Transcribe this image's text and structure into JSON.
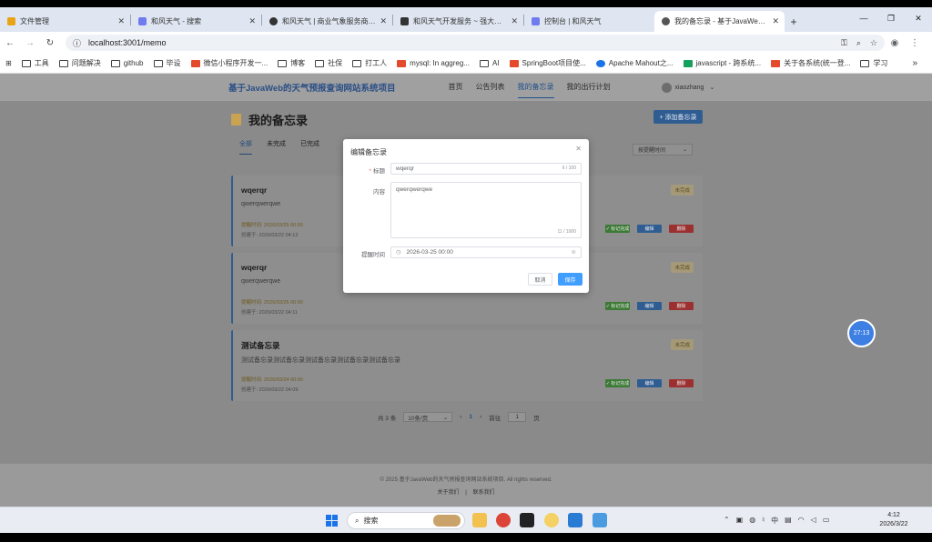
{
  "browser": {
    "tabs": [
      {
        "label": "文件管理",
        "fav": "#e8a317"
      },
      {
        "label": "和风天气 - 搜索",
        "fav": "#6f7cf0"
      },
      {
        "label": "和风天气 | 商业气象服务商, 天",
        "fav": "#333333"
      },
      {
        "label": "和风天气开发服务 ~ 强大、丰",
        "fav": "#333333"
      },
      {
        "label": "控制台 | 和风天气",
        "fav": "#6f7cf0"
      },
      {
        "label": "我的备忘录 - 基于JavaWeb的",
        "fav": "#555555"
      }
    ],
    "url": "localhost:3001/memo",
    "bookmarks": [
      {
        "label": "工具",
        "kind": "folder"
      },
      {
        "label": "问题解决",
        "kind": "folder"
      },
      {
        "label": "github",
        "kind": "folder"
      },
      {
        "label": "毕设",
        "kind": "folder"
      },
      {
        "label": "微信小程序开发一...",
        "kind": "red"
      },
      {
        "label": "博客",
        "kind": "folder"
      },
      {
        "label": "社保",
        "kind": "folder"
      },
      {
        "label": "打工人",
        "kind": "folder"
      },
      {
        "label": "mysql: In aggreg...",
        "kind": "red"
      },
      {
        "label": "AI",
        "kind": "folder"
      },
      {
        "label": "SpringBoot项目使...",
        "kind": "red"
      },
      {
        "label": "Apache Mahout之...",
        "kind": "blue"
      },
      {
        "label": "javascript - 跨系统...",
        "kind": "green"
      },
      {
        "label": "关于各系统(统一登...",
        "kind": "red"
      },
      {
        "label": "学习",
        "kind": "folder"
      }
    ]
  },
  "site": {
    "logo": "基于JavaWeb的天气预报查询网站系统项目",
    "nav": [
      "首页",
      "公告列表",
      "我的备忘录",
      "我的出行计划"
    ],
    "username": "xiaozhang"
  },
  "memo": {
    "title": "我的备忘录",
    "add_label": "+ 添加备忘录",
    "filters": [
      "全部",
      "未完成",
      "已完成"
    ],
    "sort_label": "按提醒时间",
    "cards": [
      {
        "title": "wqerqr",
        "content": "qwerqwerqwe",
        "reminder": "提醒时间: 2026/03/25 00:00",
        "created": "创建于: 2026/03/22 04:12",
        "status": "未完成"
      },
      {
        "title": "wqerqr",
        "content": "qwerqwerqwe",
        "reminder": "提醒时间: 2026/03/25 00:00",
        "created": "创建于: 2026/03/22 04:11",
        "status": "未完成"
      },
      {
        "title": "测试备忘录",
        "content": "测试备忘录测试备忘录测试备忘录测试备忘录测试备忘录",
        "reminder": "提醒时间: 2026/03/24 00:00",
        "created": "创建于: 2026/03/22 04:09",
        "status": "未完成"
      }
    ],
    "actions": {
      "done": "✓ 标记完成",
      "edit": "编辑",
      "delete": "删除"
    },
    "pager": {
      "total": "共 3 条",
      "size": "10条/页",
      "page": "1",
      "goto": "前往",
      "goto_val": "1",
      "unit": "页"
    }
  },
  "footer": {
    "copyright": "© 2025 基于JavaWeb的天气预报查询网站系统项目. All rights reserved.",
    "about": "关于我们",
    "contact": "联系我们"
  },
  "dialog": {
    "title": "编辑备忘录",
    "title_label": "标题",
    "title_value": "wqerqr",
    "title_count": "6 / 100",
    "content_label": "内容",
    "content_value": "qwerqwerqwe",
    "content_count": "11 / 1000",
    "time_label": "提醒时间",
    "time_value": "2026-03-25 00:00",
    "cancel": "取消",
    "save": "保存"
  },
  "timer": "27:13",
  "taskbar": {
    "search": "搜索",
    "time": "4:12",
    "date": "2026/3/22"
  }
}
